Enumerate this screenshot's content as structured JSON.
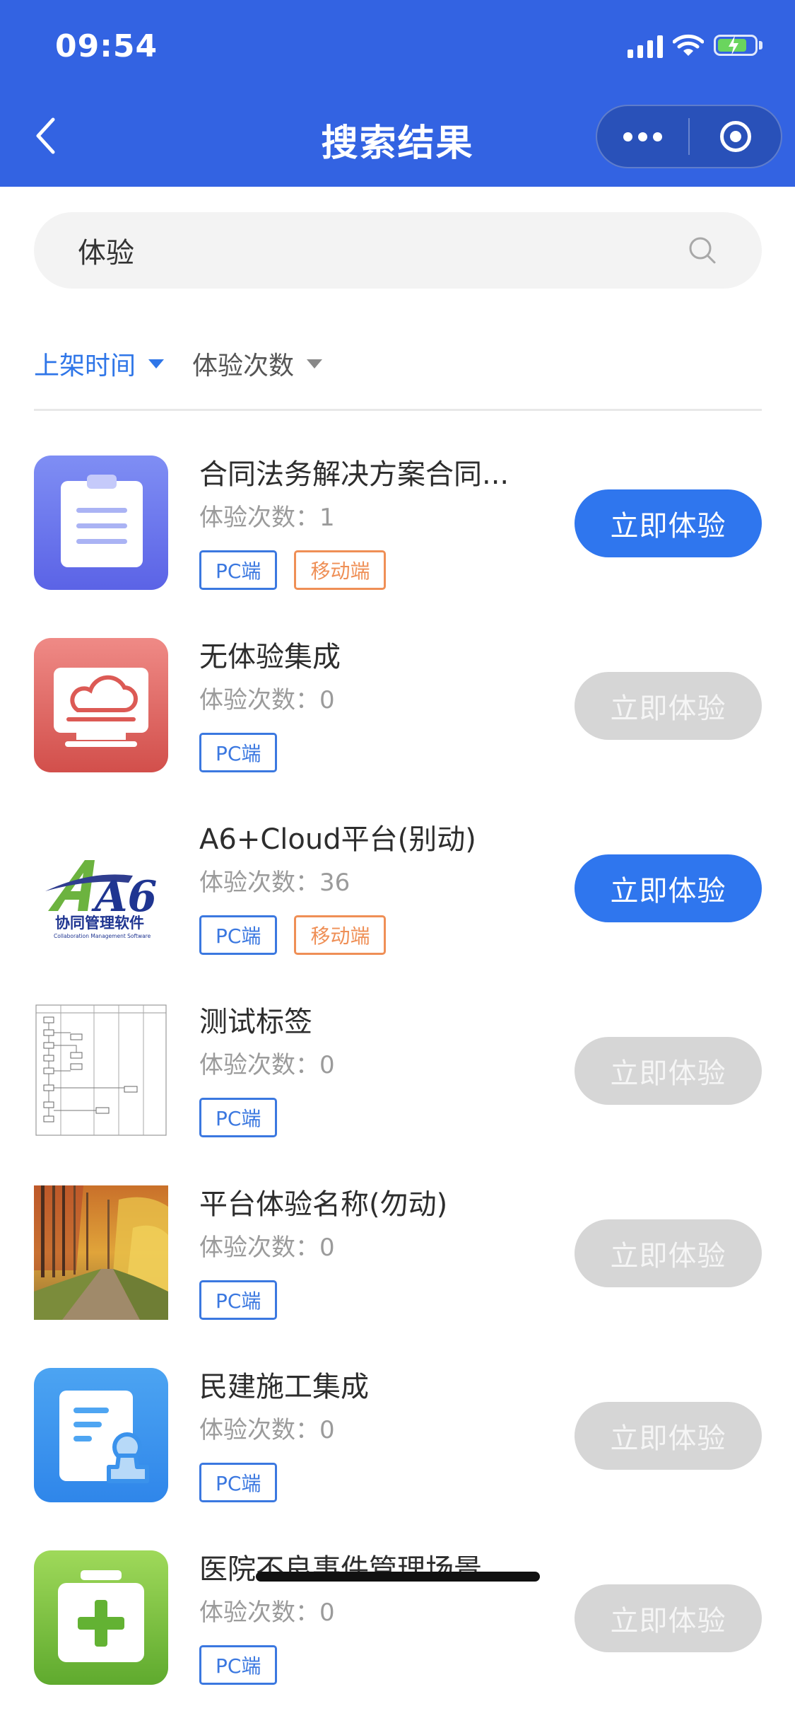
{
  "status_bar": {
    "time": "09:54"
  },
  "nav": {
    "title": "搜索结果"
  },
  "search": {
    "value": "体验"
  },
  "sort": [
    {
      "label": "上架时间",
      "active": true
    },
    {
      "label": "体验次数",
      "active": false
    }
  ],
  "count_prefix": "体验次数：",
  "action_label": "立即体验",
  "tag_labels": {
    "pc": "PC端",
    "mobile": "移动端"
  },
  "items": [
    {
      "title": "合同法务解决方案合同...",
      "count": "1",
      "tags": [
        "PC端",
        "移动端"
      ],
      "enabled": true,
      "icon": "clipboard-icon"
    },
    {
      "title": "无体验集成",
      "count": "0",
      "tags": [
        "PC端"
      ],
      "enabled": false,
      "icon": "cloud-monitor-icon"
    },
    {
      "title": "A6+Cloud平台(别动)",
      "count": "36",
      "tags": [
        "PC端",
        "移动端"
      ],
      "enabled": true,
      "icon": "a6-logo",
      "logo_text": "A6",
      "logo_subtitle": "协同管理软件",
      "logo_en": "Collaboration Management Software"
    },
    {
      "title": "测试标签",
      "count": "0",
      "tags": [
        "PC端"
      ],
      "enabled": false,
      "icon": "flowchart-thumbnail"
    },
    {
      "title": "平台体验名称(勿动)",
      "count": "0",
      "tags": [
        "PC端"
      ],
      "enabled": false,
      "icon": "autumn-forest-photo"
    },
    {
      "title": "民建施工集成",
      "count": "0",
      "tags": [
        "PC端"
      ],
      "enabled": false,
      "icon": "document-stamp-icon"
    },
    {
      "title": "医院不良事件管理场景",
      "count": "0",
      "tags": [
        "PC端"
      ],
      "enabled": false,
      "icon": "medical-kit-icon"
    }
  ],
  "colors": {
    "header_bg": "#3363e2",
    "accent": "#2f76ee",
    "tag_pc": "#3b78e0",
    "tag_mobile": "#ef8f56",
    "button_disabled": "#d6d6d6"
  }
}
